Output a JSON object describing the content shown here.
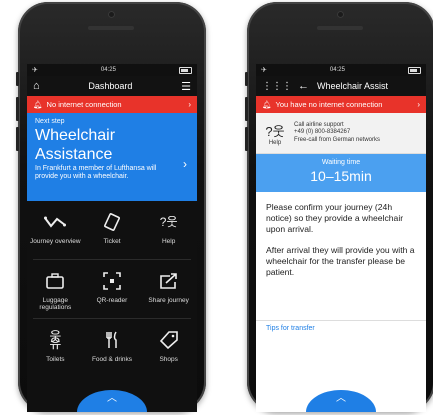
{
  "left_phone": {
    "status_time": "04:25",
    "app_title": "Dashboard",
    "alert_text": "No internet connection",
    "next_step": {
      "label": "Next step",
      "title_line1": "Wheelchair",
      "title_line2": "Assistance",
      "description": "In Frankfurt a member of Lufthansa will provide you with a wheelchair."
    },
    "tiles": [
      {
        "label": "Journey overview",
        "icon": "route-icon"
      },
      {
        "label": "Ticket",
        "icon": "ticket-icon"
      },
      {
        "label": "Help",
        "icon": "help-person-icon"
      },
      {
        "label": "Luggage regulations",
        "icon": "luggage-icon"
      },
      {
        "label": "QR-reader",
        "icon": "qr-icon"
      },
      {
        "label": "Share journey",
        "icon": "share-icon"
      },
      {
        "label": "Toilets",
        "icon": "toilet-icon"
      },
      {
        "label": "Food & drinks",
        "icon": "fork-knife-icon"
      },
      {
        "label": "Shops",
        "icon": "tag-icon"
      }
    ]
  },
  "right_phone": {
    "status_time": "04:25",
    "app_title": "Wheelchair Assist",
    "alert_text": "You have no internet connection",
    "support": {
      "icon_label": "Help",
      "line1": "Call airline support",
      "line2": "+49 (0) 800-8384267",
      "line3": "Free-call from German networks"
    },
    "waiting": {
      "label": "Waiting time",
      "value": "10–15min"
    },
    "paragraph1": "Please confirm your journey (24h notice) so they provide a wheelchair upon arrival.",
    "paragraph2": "After arrival they will provide you with a wheelchair for the transfer please be patient.",
    "tips_link": "Tips for transfer"
  },
  "colors": {
    "accent_blue": "#1f7fe5",
    "alert_red": "#e8332a",
    "waiting_blue": "#4ba0f0"
  }
}
